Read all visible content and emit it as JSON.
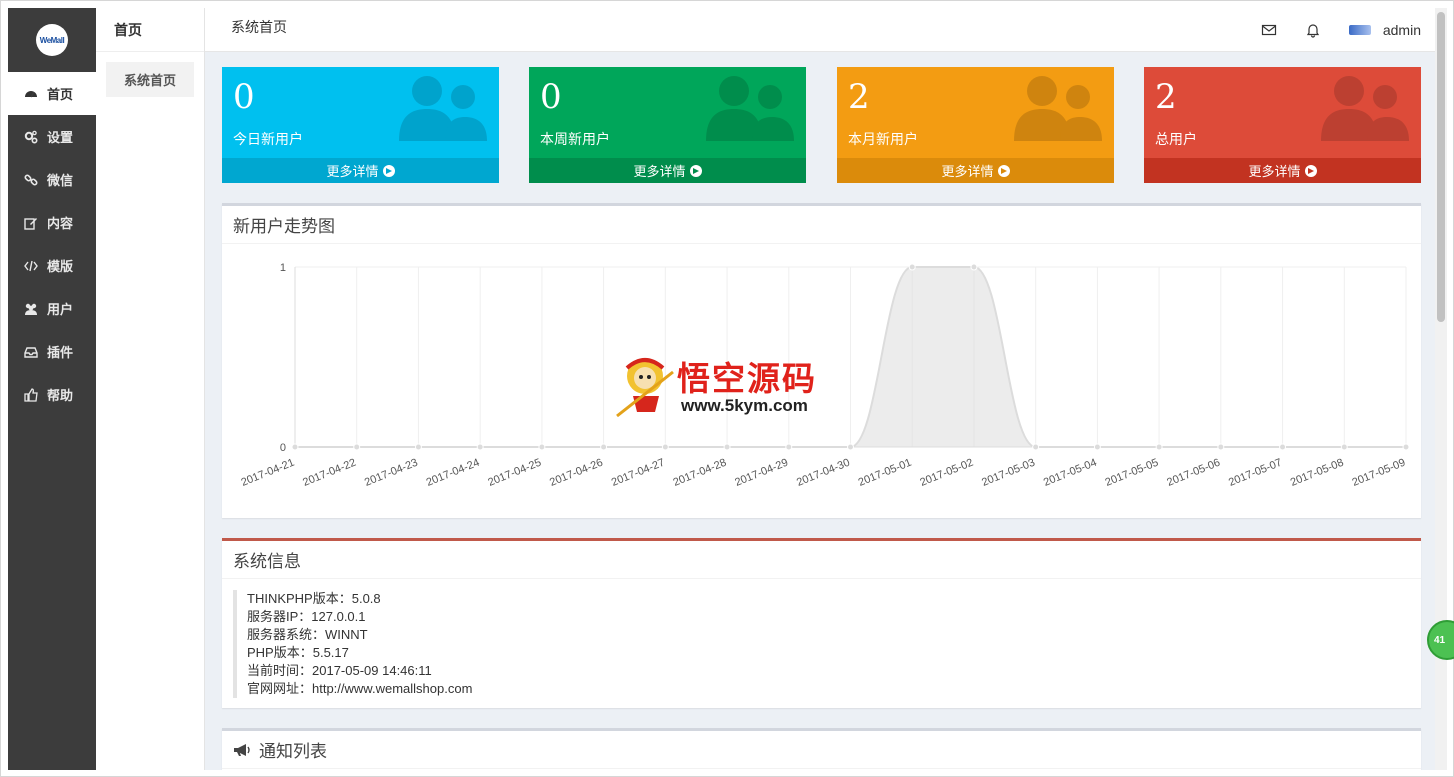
{
  "sidebar": {
    "logo_text": "WeMall",
    "items": [
      {
        "label": "首页",
        "icon": "dashboard-icon",
        "active": true
      },
      {
        "label": "设置",
        "icon": "gears-icon"
      },
      {
        "label": "微信",
        "icon": "link-icon"
      },
      {
        "label": "内容",
        "icon": "edit-icon"
      },
      {
        "label": "模版",
        "icon": "code-icon"
      },
      {
        "label": "用户",
        "icon": "users-icon"
      },
      {
        "label": "插件",
        "icon": "inbox-icon"
      },
      {
        "label": "帮助",
        "icon": "thumbs-up-icon"
      }
    ]
  },
  "subbar": {
    "title": "首页",
    "items": [
      {
        "label": "系统首页"
      }
    ]
  },
  "header": {
    "title": "系统首页",
    "username": "admin"
  },
  "stats": [
    {
      "value": "0",
      "label": "今日新用户",
      "more": "更多详情",
      "color": "#00c0ef",
      "footer": "#00a7d0",
      "icon_color": "#00a3cc"
    },
    {
      "value": "0",
      "label": "本周新用户",
      "more": "更多详情",
      "color": "#00a65a",
      "footer": "#008d4c",
      "icon_color": "#008d4c"
    },
    {
      "value": "2",
      "label": "本月新用户",
      "more": "更多详情",
      "color": "#f39c12",
      "footer": "#db8b0b",
      "icon_color": "#cf840f"
    },
    {
      "value": "2",
      "label": "总用户",
      "more": "更多详情",
      "color": "#dd4b39",
      "footer": "#c23321",
      "icon_color": "#bc4031"
    }
  ],
  "chart_box": {
    "title": "新用户走势图"
  },
  "chart_data": {
    "type": "area",
    "title": "新用户走势图",
    "x": [
      "2017-04-21",
      "2017-04-22",
      "2017-04-23",
      "2017-04-24",
      "2017-04-25",
      "2017-04-26",
      "2017-04-27",
      "2017-04-28",
      "2017-04-29",
      "2017-04-30",
      "2017-05-01",
      "2017-05-02",
      "2017-05-03",
      "2017-05-04",
      "2017-05-05",
      "2017-05-06",
      "2017-05-07",
      "2017-05-08",
      "2017-05-09"
    ],
    "series": [
      {
        "values": [
          0,
          0,
          0,
          0,
          0,
          0,
          0,
          0,
          0,
          0,
          1,
          1,
          0,
          0,
          0,
          0,
          0,
          0,
          0
        ]
      }
    ],
    "yticks": [
      "0",
      "1"
    ],
    "ylim": [
      0,
      1
    ],
    "grid": true
  },
  "sysinfo_box": {
    "title": "系统信息",
    "lines": [
      "THINKPHP版本：5.0.8",
      "服务器IP：127.0.0.1",
      "服务器系统：WINNT",
      "PHP版本：5.5.17",
      "当前时间：2017-05-09 14:46:11",
      "官网网址：http://www.wemallshop.com"
    ]
  },
  "notice_box": {
    "title": "通知列表"
  },
  "watermark": {
    "title": "悟空源码",
    "url": "www.5kym.com"
  },
  "float_badge": "41"
}
